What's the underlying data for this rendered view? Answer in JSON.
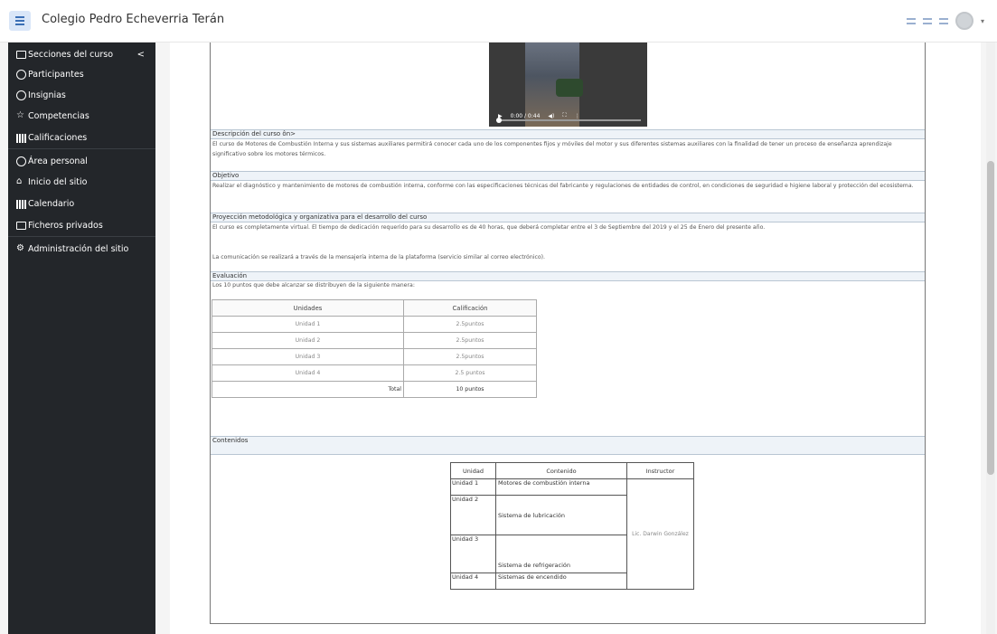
{
  "header": {
    "site_title": "Colegio Pedro Echeverria Terán"
  },
  "sidebar": {
    "items": [
      {
        "label": "Secciones del curso",
        "icon": "folder-icon"
      },
      {
        "label": "Participantes",
        "icon": "users-icon"
      },
      {
        "label": "Insignias",
        "icon": "badge-icon"
      },
      {
        "label": "Competencias",
        "icon": "star-icon"
      },
      {
        "label": "Calificaciones",
        "icon": "grades-icon"
      },
      {
        "label": "Área personal",
        "icon": "dashboard-icon"
      },
      {
        "label": "Inicio del sitio",
        "icon": "home-icon"
      },
      {
        "label": "Calendario",
        "icon": "calendar-icon"
      },
      {
        "label": "Ficheros privados",
        "icon": "file-icon"
      },
      {
        "label": "Administración del sitio",
        "icon": "gear-icon"
      }
    ],
    "collapse_symbol": "<"
  },
  "video": {
    "time": "0:00 / 0:44"
  },
  "sections": {
    "descripcion": {
      "title": "Descripción del curso ôn>",
      "text": "El curso de Motores de Combustión Interna y sus sistemas auxiliares permitirá conocer cada uno de los componentes fijos y móviles del motor y sus diferentes sistemas auxiliares con la finalidad de tener un proceso de enseñanza aprendizaje significativo sobre los motores térmicos."
    },
    "objetivo": {
      "title": "Objetivo",
      "text": "Realizar el diagnóstico y mantenimiento de motores de combustión interna, conforme con las especificaciones técnicas del fabricante y regulaciones de entidades de control, en condiciones de seguridad e higiene laboral y protección del ecosistema."
    },
    "proyeccion": {
      "title": "Proyección metodológica y organizativa para el desarrollo del curso",
      "text1": "El curso es completamente virtual. El tiempo de dedicación requerido para su desarrollo es de 40 horas, que deberá completar entre el 3 de Septiembre del 2019 y el 25 de Enero del presente año.",
      "text2": "La comunicación se realizará a través de la mensajería interna de la plataforma (servicio similar al correo electrónico)."
    },
    "evaluacion": {
      "title": "Evaluación",
      "text": "Los 10 puntos que debe alcanzar se distribuyen de la siguiente manera:",
      "headers": [
        "Unidades",
        "Calificación"
      ],
      "rows": [
        [
          "Unidad 1",
          "2.5puntos"
        ],
        [
          "Unidad 2",
          "2.5puntos"
        ],
        [
          "Unidad 3",
          "2.5puntos"
        ],
        [
          "Unidad 4",
          "2.5 puntos"
        ]
      ],
      "total_label": "Total",
      "total_value": "10 puntos"
    },
    "contenidos": {
      "title": "Contenidos",
      "headers": [
        "Unidad",
        "Contenido",
        "Instructor"
      ],
      "rows": [
        [
          "Unidad 1",
          "Motores de combustión interna"
        ],
        [
          "Unidad 2",
          "Sistema de lubricación"
        ],
        [
          "Unidad 3",
          "Sistema de refrigeración"
        ],
        [
          "Unidad 4",
          "Sistemas de encendido"
        ]
      ],
      "instructor": "Lic. Darwin González"
    }
  }
}
